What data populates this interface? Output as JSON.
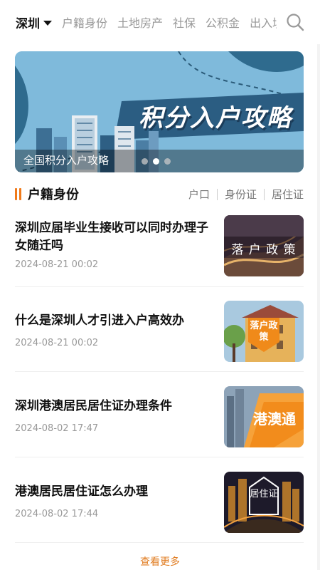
{
  "topnav": {
    "city": "深圳",
    "items": [
      "户籍身份",
      "土地房产",
      "社保",
      "公积金",
      "出入境"
    ]
  },
  "banner": {
    "title": "积分入户攻略",
    "caption": "全国积分入户攻略",
    "dots": 3,
    "active_dot": 2
  },
  "section": {
    "title": "户籍身份",
    "tabs": [
      "户口",
      "身份证",
      "居住证"
    ]
  },
  "articles": [
    {
      "title": "深圳应届毕业生接收可以同时办理子女随迁吗",
      "date": "2024-08-21 00:02",
      "thumb_text": "落 户 政 策"
    },
    {
      "title": "什么是深圳人才引进入户高效办",
      "date": "2024-08-21 00:02",
      "thumb_text": "落户政策"
    },
    {
      "title": "深圳港澳居民居住证办理条件",
      "date": "2024-08-02 17:47",
      "thumb_text": "港澳通"
    },
    {
      "title": "港澳居民居住证怎么办理",
      "date": "2024-08-02 17:44",
      "thumb_text": "居住证"
    }
  ],
  "more_label": "查看更多",
  "colors": {
    "accent": "#f07a1a",
    "banner_bg": "#79b7d8"
  }
}
